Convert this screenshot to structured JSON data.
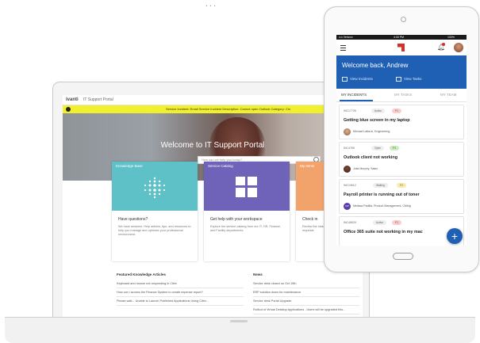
{
  "laptop": {
    "camera_dots": "• • •",
    "portal": {
      "logo": "ivanti",
      "title": "IT Support Portal",
      "alert_text": "Service Incident: Email Service Incident Description: Cannot open Outlook Category: Clo",
      "hero_title": "Welcome to IT Support Portal",
      "search_placeholder": "How can we help you today?",
      "tiles": [
        {
          "label": "Knowledge Base",
          "heading": "Have questions?",
          "description": "We have answers. Help articles, tips, and resources to help you manage and optimize your professional environment.",
          "color": "#5fc1c8",
          "icon": "dot-grid-icon"
        },
        {
          "label": "Service Catalog",
          "heading": "Get help with your workspace",
          "description": "Explore the service catalog from our IT, HR, Finance, and Facility departments.",
          "color": "#6e63b8",
          "icon": "grid-squares-icon"
        },
        {
          "label": "My Items",
          "heading": "Check in",
          "description": "Review the status of your incidents and requests",
          "color": "#f2a36c",
          "icon": ""
        }
      ],
      "featured": {
        "title": "Featured Knowledge Articles",
        "items": [
          "Keyboard and mouse not responding in Citrix",
          "How can I access the Finance System to create expense report?",
          "Please wait... Unable to Launch Published Applications Using Citrix..."
        ]
      },
      "news": {
        "title": "News",
        "items": [
          "Service desk closed on Oct 15th",
          "ERP solution down for maintenance",
          "Service desk Portal Upgrade",
          "Rollout of Virtual Desktop Applications - Users will be upgraded this..."
        ]
      }
    }
  },
  "phone": {
    "status": {
      "carrier": "•••• Verizon",
      "time": "4:30 PM",
      "battery": "100%"
    },
    "brand_color": "#d0312d",
    "accent": "#1f5fb4",
    "welcome": "Welcome back, Andrew",
    "view_incidents": "View Incidents",
    "view_tasks": "View Tasks",
    "tabs": [
      "MY INCIDENTS",
      "MY TASKS",
      "MY TEAM"
    ],
    "incidents": [
      {
        "id": "INC17705",
        "status": "Active",
        "priority": "P1",
        "title": "Getting blue screen in my laptop",
        "person": "Michael Latterzi, Engineering",
        "avatar": "photo",
        "priority_color": "#f6d0cc"
      },
      {
        "id": "INC4765",
        "status": "Open",
        "priority": "P3",
        "title": "Outlook client not working",
        "person": "Julia Murphy, Sales",
        "avatar": "photo",
        "priority_color": "#cdebc3"
      },
      {
        "id": "INC19612",
        "status": "Waiting",
        "priority": "P2",
        "title": "Payroll printer is running out of toner",
        "person": "Melissa Padilla, Product Management, CMktg",
        "avatar": "MP",
        "priority_color": "#f7ecb0"
      },
      {
        "id": "INC46529",
        "status": "Active",
        "priority": "P1",
        "title": "Office 365 suite not working in my mac",
        "person": "",
        "avatar": "",
        "priority_color": "#f6d0cc"
      }
    ],
    "fab_label": "+"
  }
}
